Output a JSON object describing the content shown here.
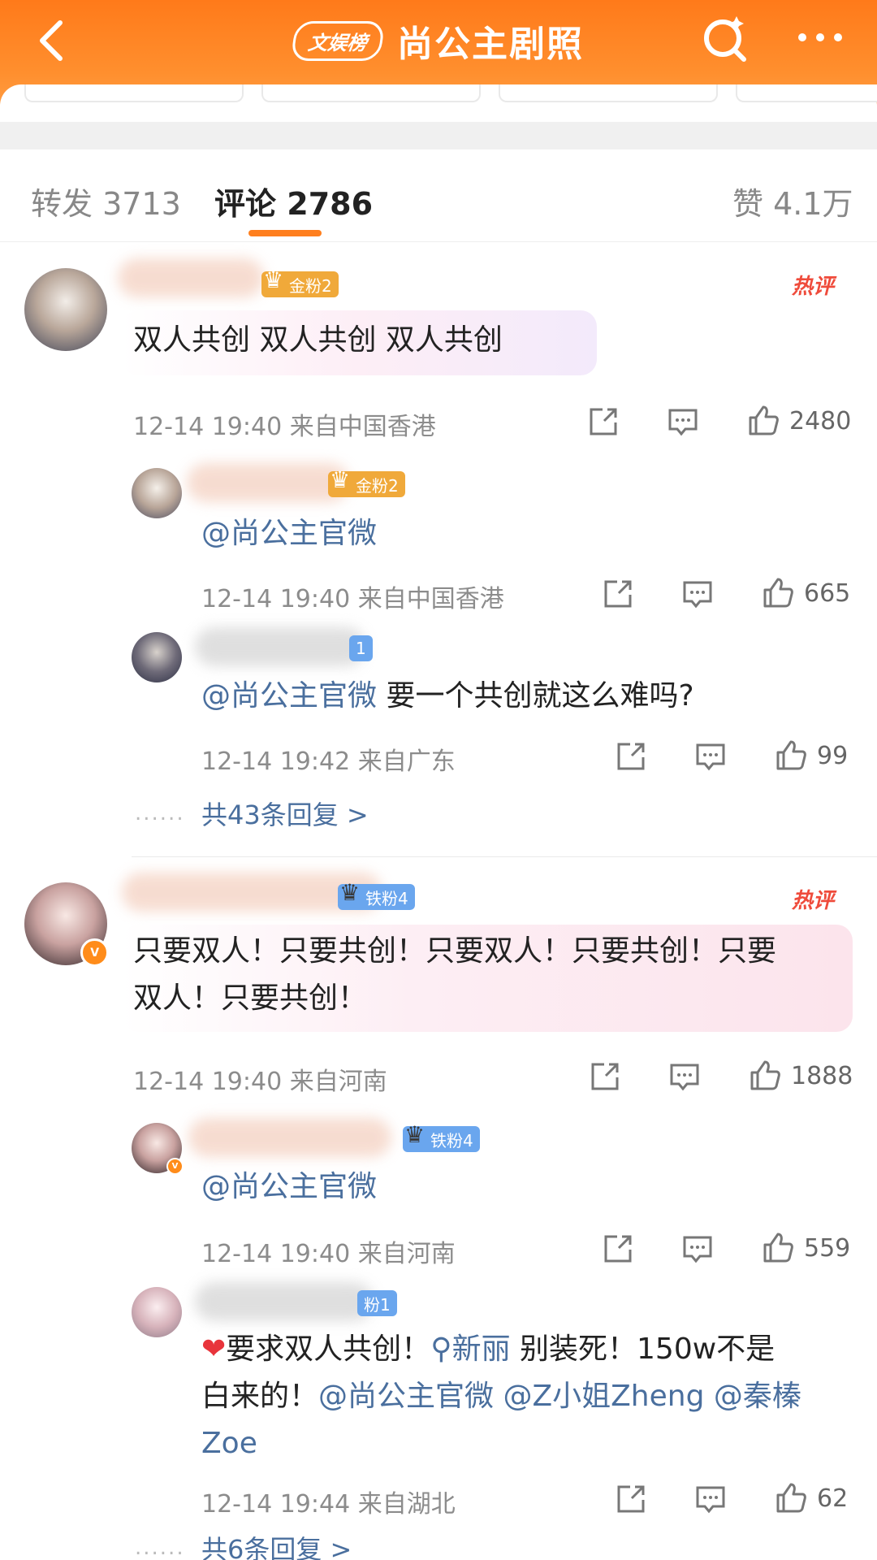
{
  "header": {
    "back_label": "back",
    "badge": "文娱榜",
    "title": "尚公主剧照"
  },
  "tabs": [
    {
      "label": "转发",
      "count": "3713"
    },
    {
      "label": "评论",
      "count": "2786"
    },
    {
      "label": "赞",
      "count": "4.1万"
    }
  ],
  "comments": [
    {
      "badge": "金粉2",
      "hot": "热评",
      "text": "双人共创 双人共创 双人共创",
      "time": "12-14 19:40",
      "location": "来自中国香港",
      "likes": "2480",
      "replies": [
        {
          "badge": "金粉2",
          "text": "@尚公主官微",
          "time": "12-14 19:40",
          "location": "来自中国香港",
          "likes": "665"
        },
        {
          "badge": "1",
          "mention": "@尚公主官微",
          "text": " 要一个共创就这么难吗?",
          "time": "12-14 19:42",
          "location": "来自广东",
          "likes": "99"
        }
      ],
      "more_replies": "共43条回复 >"
    },
    {
      "badge": "铁粉4",
      "hot": "热评",
      "text_line1": "只要双人！只要共创！只要双人！只要共创！只要",
      "text_line2": "双人！只要共创！",
      "time": "12-14 19:40",
      "location": "来自河南",
      "likes": "1888",
      "replies": [
        {
          "badge": "铁粉4",
          "text": "@尚公主官微",
          "time": "12-14 19:40",
          "location": "来自河南",
          "likes": "559"
        },
        {
          "badge": "粉1",
          "line1_a": "要求双人共创！",
          "line1_topic": "新丽",
          "line1_b": " 别装死！150w不是",
          "line2_a": "白来的！",
          "line2_mentions": "@尚公主官微 @Z小姐Zheng @秦榛",
          "line3": "Zoe",
          "time": "12-14 19:44",
          "location": "来自湖北",
          "likes": "62"
        }
      ],
      "more_replies": "共6条回复 >"
    }
  ],
  "dots": "......",
  "colors": {
    "accent": "#ff7f1e",
    "link": "#4a6f9e",
    "hot": "#ef4b3b"
  }
}
